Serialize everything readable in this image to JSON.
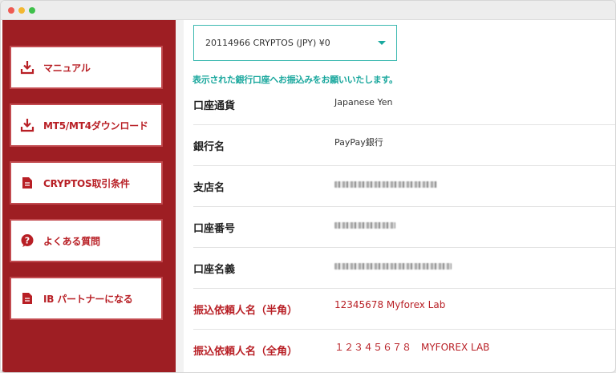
{
  "sidebar": {
    "items": [
      {
        "label": "マニュアル",
        "icon": "download-icon"
      },
      {
        "label": "MT5/MT4ダウンロード",
        "icon": "download-icon"
      },
      {
        "label": "CRYPTOS取引条件",
        "icon": "document-icon"
      },
      {
        "label": "よくある質問",
        "icon": "question-icon"
      },
      {
        "label": "IB パートナーになる",
        "icon": "document-icon"
      }
    ]
  },
  "account_select": {
    "value": "20114966 CRYPTOS (JPY) ¥0"
  },
  "notice": "表示された銀行口座へお振込みをお願いいたします。",
  "bank_details": [
    {
      "label": "口座通貨",
      "value": "Japanese Yen"
    },
    {
      "label": "銀行名",
      "value": "PayPay銀行"
    },
    {
      "label": "支店名",
      "value": ""
    },
    {
      "label": "口座番号",
      "value": ""
    },
    {
      "label": "口座名義",
      "value": ""
    },
    {
      "label": "振込依頼人名（半角）",
      "value": "12345678 Myforex Lab"
    },
    {
      "label": "振込依頼人名（全角）",
      "value": "１２３４５６７８　MYFOREX LAB"
    }
  ],
  "colors": {
    "sidebar_bg": "#9e1e23",
    "accent_red": "#b81f25",
    "accent_teal": "#19a79d"
  }
}
